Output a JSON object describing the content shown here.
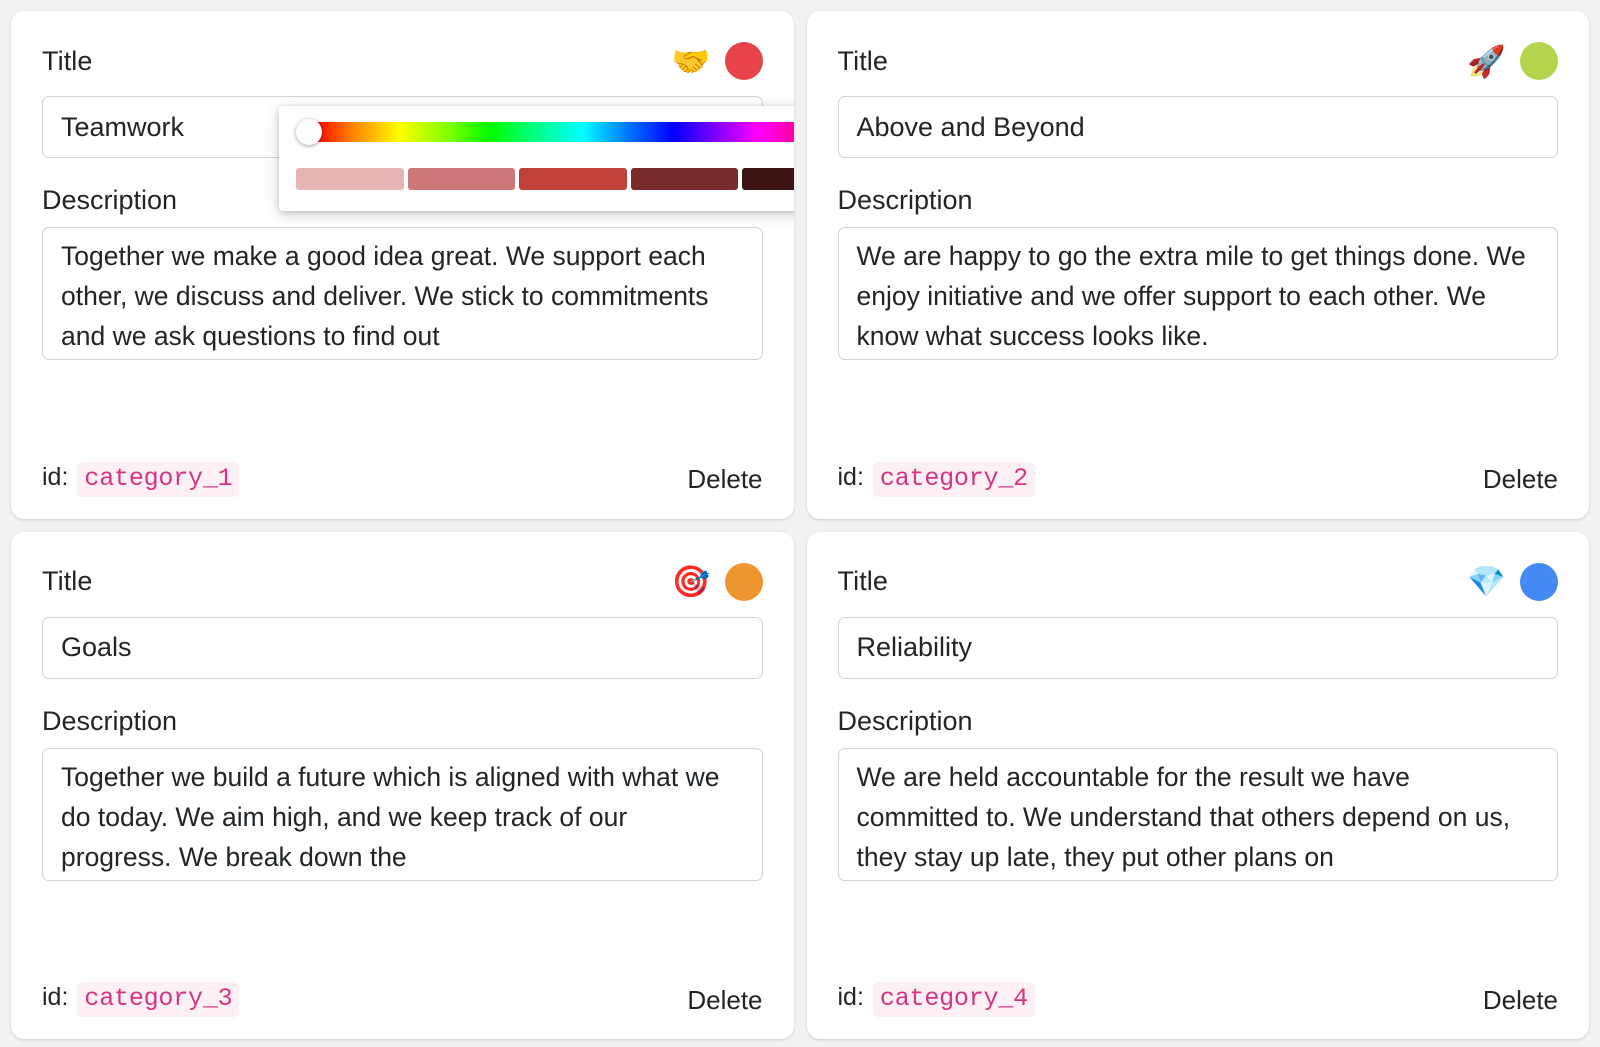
{
  "page": {
    "background_color": "#f2f2f3",
    "card_background": "#ffffff"
  },
  "labels": {
    "title_label": "Title",
    "description_label": "Description",
    "id_label": "id:",
    "delete_label": "Delete"
  },
  "cards": [
    {
      "emoji": "🤝",
      "emoji_name": "handshake-emoji",
      "color": "#e8434a",
      "title_value": "Teamwork",
      "title_placeholder": "Title",
      "description_value": "Together we make a good idea great. We support each other, we discuss and deliver. We stick to commitments and we ask questions to find out",
      "description_placeholder": "Description",
      "id": "category_1"
    },
    {
      "emoji": "🚀",
      "emoji_name": "rocket-emoji",
      "color": "#b5d44d",
      "title_value": "Above and Beyond",
      "title_placeholder": "Title",
      "description_value": "We are happy to go the extra mile to get things done. We enjoy initiative and we offer support to each other. We know what success looks like.",
      "description_placeholder": "Description",
      "id": "category_2"
    },
    {
      "emoji": "🎯",
      "emoji_name": "dart-target-emoji",
      "color": "#ed962f",
      "title_value": "Goals",
      "title_placeholder": "Title",
      "description_value": "Together we build a future which is aligned with what we do today. We aim high, and we keep track of our progress. We break down the",
      "description_placeholder": "Description",
      "id": "category_3"
    },
    {
      "emoji": "💎",
      "emoji_name": "gem-diamond-emoji",
      "color": "#4589f5",
      "title_value": "Reliability",
      "title_placeholder": "Title",
      "description_value": "We are held accountable for the result we have committed to. We understand that others depend on us, they stay up late, they put other plans on",
      "description_placeholder": "Description",
      "id": "category_4"
    }
  ],
  "color_picker": {
    "open": true,
    "anchor_card_index": 0,
    "hue_position_percent": 0,
    "hue_value": "#ff0000",
    "shades": [
      "#e6b4b4",
      "#cc7878",
      "#c0403c",
      "#7a2c2c",
      "#3d1414"
    ],
    "shade_names": [
      "shade-100",
      "shade-300",
      "shade-500",
      "shade-700",
      "shade-900"
    ]
  }
}
